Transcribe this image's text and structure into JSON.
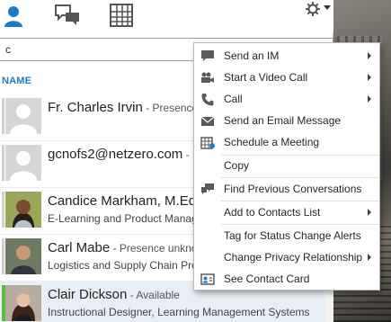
{
  "search": {
    "value": "c"
  },
  "list": {
    "column_header": "NAME"
  },
  "contacts": [
    {
      "name": "Fr. Charles Irvin",
      "status": " - Presence",
      "subtitle": ""
    },
    {
      "name": "gcnofs2@netzero.com",
      "status": " - P",
      "subtitle": ""
    },
    {
      "name": "Candice Markham, M.Ed.",
      "status": "",
      "subtitle": "E-Learning and Product Manag"
    },
    {
      "name": "Carl Mabe",
      "status": " - Presence unkno",
      "subtitle": "Logistics and Supply Chain Pro"
    },
    {
      "name": "Clair Dickson",
      "status": " - Available",
      "subtitle": "Instructional Designer, Learning Management Systems"
    }
  ],
  "context_menu": {
    "items": [
      {
        "label": "Send an IM",
        "icon": "im-icon",
        "submenu": true
      },
      {
        "label": "Start a Video Call",
        "icon": "video-camera-icon",
        "submenu": true
      },
      {
        "label": "Call",
        "icon": "phone-icon",
        "submenu": true
      },
      {
        "label": "Send an Email Message",
        "icon": "email-icon",
        "submenu": false
      },
      {
        "label": "Schedule a Meeting",
        "icon": "calendar-icon",
        "submenu": false
      },
      {
        "label": "Copy",
        "icon": "",
        "submenu": false
      },
      {
        "label": "Find Previous Conversations",
        "icon": "conversation-history-icon",
        "submenu": false
      },
      {
        "label": "Add to Contacts List",
        "icon": "",
        "submenu": true
      },
      {
        "label": "Tag for Status Change Alerts",
        "icon": "",
        "submenu": false
      },
      {
        "label": "Change Privacy Relationship",
        "icon": "",
        "submenu": true
      },
      {
        "label": "See Contact Card",
        "icon": "contact-card-icon",
        "submenu": false
      }
    ]
  },
  "colors": {
    "accent": "#1d7bc3",
    "available": "#5dbb3a",
    "selected_row": "#e8eef5"
  }
}
